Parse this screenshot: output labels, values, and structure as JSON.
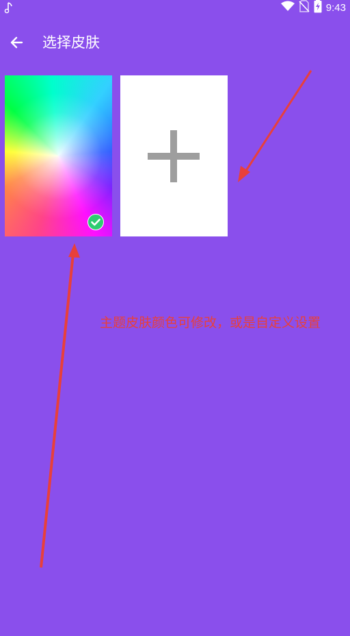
{
  "status_bar": {
    "time": "9:43",
    "icons": [
      "music-note-icon",
      "wifi-icon",
      "no-sim-icon",
      "battery-charging-icon"
    ]
  },
  "app_bar": {
    "back_icon": "arrow-left-icon",
    "title": "选择皮肤"
  },
  "skins": [
    {
      "type": "color-gradient",
      "selected": true,
      "badge_icon": "check-circle-icon"
    },
    {
      "type": "custom-add",
      "selected": false,
      "icon": "plus-icon"
    }
  ],
  "annotation": {
    "text": "主题皮肤颜色可修改，或是自定义设置"
  },
  "colors": {
    "background": "#8a4fec",
    "accent_check": "#2ecc71",
    "annotation": "#e8403b",
    "plus_icon": "#9e9e9e"
  }
}
